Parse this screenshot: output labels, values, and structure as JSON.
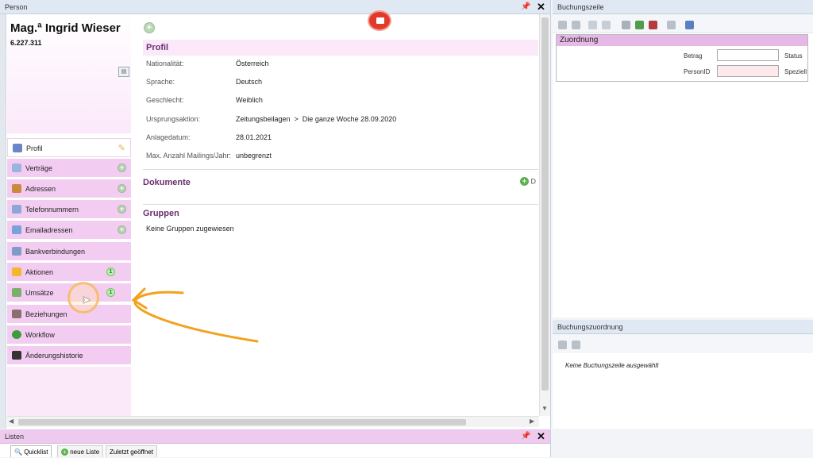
{
  "person_panel": {
    "title": "Person",
    "pin_icon": "pin-icon",
    "close_label": "✕"
  },
  "person": {
    "name": "Mag.ª Ingrid Wieser",
    "number": "6.227.311"
  },
  "nav": {
    "items": [
      {
        "label": "Profil",
        "icon": "person-icon",
        "color": "#6a86c7",
        "edit": "pencil-icon"
      },
      {
        "label": "Verträge",
        "icon": "contract-icon",
        "color": "#9ab4df",
        "plus": "+"
      },
      {
        "label": "Adressen",
        "icon": "house-icon",
        "color": "#c98a3b",
        "plus": "+"
      },
      {
        "label": "Telefonnummern",
        "icon": "phone-icon",
        "color": "#8ca6d6",
        "plus": "+"
      },
      {
        "label": "Emailadressen",
        "icon": "mail-icon",
        "color": "#7aa1d8",
        "plus": "+"
      },
      {
        "label": "Bankverbindungen",
        "icon": "bank-icon",
        "color": "#7f9cc9"
      },
      {
        "label": "Aktionen",
        "icon": "lightning-icon",
        "color": "#f2b72c",
        "badge": "1"
      },
      {
        "label": "Umsätze",
        "icon": "money-icon",
        "color": "#7bae6a",
        "badge": "1"
      },
      {
        "label": "Beziehungen",
        "icon": "people-icon",
        "color": "#8b6f6f"
      },
      {
        "label": "Workflow",
        "icon": "workflow-icon",
        "color": "#3e9c3c"
      },
      {
        "label": "Änderungshistorie",
        "icon": "history-icon",
        "color": "#333"
      }
    ]
  },
  "profil": {
    "section_title": "Profil",
    "fields": [
      {
        "label": "Nationalität:",
        "value": "Österreich"
      },
      {
        "label": "Sprache:",
        "value": "Deutsch"
      },
      {
        "label": "Geschlecht:",
        "value": "Weiblich"
      },
      {
        "label": "Ursprungsaktion:",
        "value": "Zeitungsbeilagen  >  Die ganze Woche 28.09.2020"
      },
      {
        "label": "Anlagedatum:",
        "value": "28.01.2021"
      },
      {
        "label": "Max. Anzahl Mailings/Jahr:",
        "value": "unbegrenzt"
      }
    ]
  },
  "dokumente": {
    "section_title": "Dokumente",
    "add_label": "D"
  },
  "gruppen": {
    "section_title": "Gruppen",
    "empty_text": "Keine Gruppen zugewiesen"
  },
  "buchungszeile": {
    "title": "Buchungszeile",
    "zuordnung_title": "Zuordnung",
    "betrag_label": "Betrag",
    "status_label": "Status",
    "personid_label": "PersonID",
    "speziell_label": "Speziell",
    "betrag_value": "",
    "personid_value": ""
  },
  "buchungszuordnung": {
    "title": "Buchungszuordnung",
    "empty_text": "Keine Buchungszeile ausgewählt"
  },
  "listen": {
    "title": "Listen",
    "tabs": [
      {
        "label": "Quicklist",
        "icon": "search-icon"
      },
      {
        "label": "neue Liste",
        "icon": "add-icon"
      },
      {
        "label": "Zuletzt geöffnet"
      }
    ]
  },
  "colors": {
    "nav_bg": "#f3cdf1",
    "section_title": "#6a2f6e",
    "record_button": "#e03a2c",
    "annotation_arrow": "#f2a21d"
  }
}
